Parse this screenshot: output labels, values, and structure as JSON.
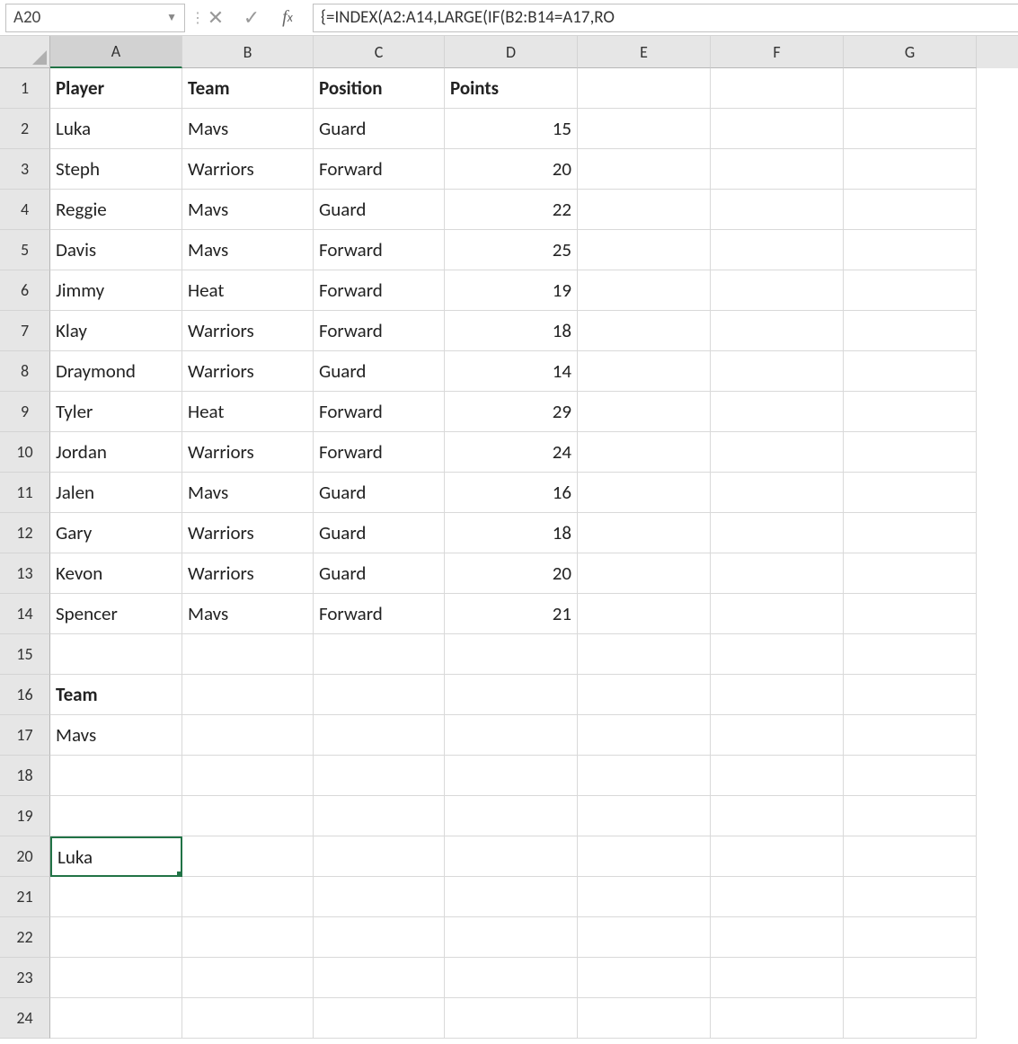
{
  "nameBox": {
    "value": "A20"
  },
  "formulaBar": {
    "value": "{=INDEX(A2:A14,LARGE(IF(B2:B14=A17,RO"
  },
  "columns": [
    "A",
    "B",
    "C",
    "D",
    "E",
    "F",
    "G"
  ],
  "rowCount": 24,
  "activeColumn": "A",
  "selectedCell": {
    "row": 20,
    "col": "A"
  },
  "cells": {
    "A1": {
      "text": "Player",
      "bold": true
    },
    "B1": {
      "text": "Team",
      "bold": true
    },
    "C1": {
      "text": "Position",
      "bold": true
    },
    "D1": {
      "text": "Points",
      "bold": true
    },
    "A2": {
      "text": "Luka"
    },
    "B2": {
      "text": "Mavs"
    },
    "C2": {
      "text": "Guard"
    },
    "D2": {
      "text": "15",
      "num": true
    },
    "A3": {
      "text": "Steph"
    },
    "B3": {
      "text": "Warriors"
    },
    "C3": {
      "text": "Forward"
    },
    "D3": {
      "text": "20",
      "num": true
    },
    "A4": {
      "text": "Reggie"
    },
    "B4": {
      "text": "Mavs"
    },
    "C4": {
      "text": "Guard"
    },
    "D4": {
      "text": "22",
      "num": true
    },
    "A5": {
      "text": "Davis"
    },
    "B5": {
      "text": "Mavs"
    },
    "C5": {
      "text": "Forward"
    },
    "D5": {
      "text": "25",
      "num": true
    },
    "A6": {
      "text": "Jimmy"
    },
    "B6": {
      "text": "Heat"
    },
    "C6": {
      "text": "Forward"
    },
    "D6": {
      "text": "19",
      "num": true
    },
    "A7": {
      "text": "Klay"
    },
    "B7": {
      "text": "Warriors"
    },
    "C7": {
      "text": "Forward"
    },
    "D7": {
      "text": "18",
      "num": true
    },
    "A8": {
      "text": "Draymond"
    },
    "B8": {
      "text": "Warriors"
    },
    "C8": {
      "text": "Guard"
    },
    "D8": {
      "text": "14",
      "num": true
    },
    "A9": {
      "text": "Tyler"
    },
    "B9": {
      "text": "Heat"
    },
    "C9": {
      "text": "Forward"
    },
    "D9": {
      "text": "29",
      "num": true
    },
    "A10": {
      "text": "Jordan"
    },
    "B10": {
      "text": "Warriors"
    },
    "C10": {
      "text": "Forward"
    },
    "D10": {
      "text": "24",
      "num": true
    },
    "A11": {
      "text": "Jalen"
    },
    "B11": {
      "text": "Mavs"
    },
    "C11": {
      "text": "Guard"
    },
    "D11": {
      "text": "16",
      "num": true
    },
    "A12": {
      "text": "Gary"
    },
    "B12": {
      "text": "Warriors"
    },
    "C12": {
      "text": "Guard"
    },
    "D12": {
      "text": "18",
      "num": true
    },
    "A13": {
      "text": "Kevon"
    },
    "B13": {
      "text": "Warriors"
    },
    "C13": {
      "text": "Guard"
    },
    "D13": {
      "text": "20",
      "num": true
    },
    "A14": {
      "text": "Spencer"
    },
    "B14": {
      "text": "Mavs"
    },
    "C14": {
      "text": "Forward"
    },
    "D14": {
      "text": "21",
      "num": true
    },
    "A16": {
      "text": "Team",
      "bold": true
    },
    "A17": {
      "text": "Mavs"
    },
    "A20": {
      "text": "Luka"
    }
  }
}
